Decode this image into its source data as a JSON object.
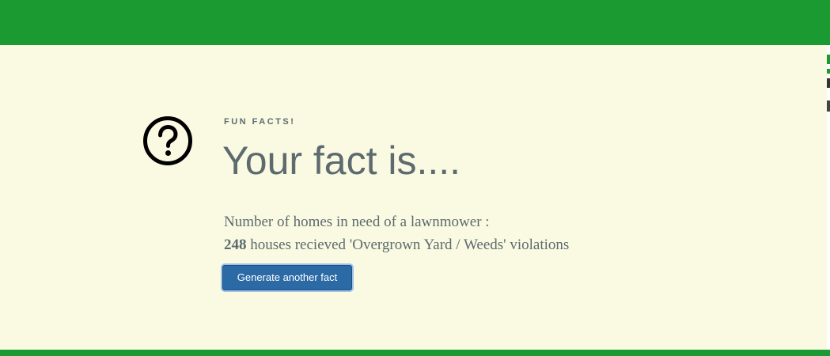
{
  "colors": {
    "header_bar": "#1b9a31",
    "background": "#fafae2",
    "text": "#5d6a6e",
    "button": "#2c6aa6"
  },
  "icon": "question-circle-icon",
  "fact": {
    "eyebrow": "FUN FACTS!",
    "headline": "Your fact is....",
    "question": "Number of homes in need of a lawnmower :",
    "count": "248",
    "answer_text": " houses recieved 'Overgrown Yard / Weeds' violations"
  },
  "actions": {
    "generate_label": "Generate another fact"
  }
}
